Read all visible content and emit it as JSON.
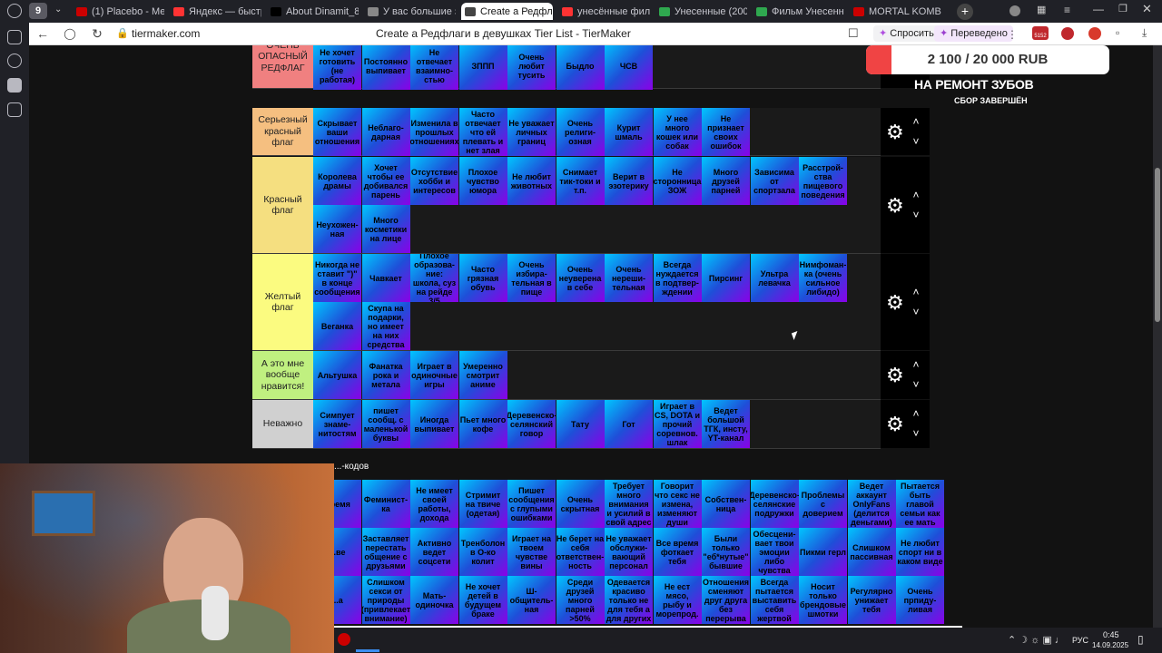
{
  "browser": {
    "tab_counter": "9",
    "tabs": [
      {
        "title": "(1) Placebo - Medi",
        "color": "#cc0000"
      },
      {
        "title": "Яндекс — быстрый",
        "color": "#ff3333"
      },
      {
        "title": "About Dinamit_8 - V",
        "color": "#000000"
      },
      {
        "title": "У вас большие зап",
        "color": "#888888"
      },
      {
        "title": "Create a Редфла",
        "color": "#444444"
      },
      {
        "title": "унесённые фильм",
        "color": "#ff3333"
      },
      {
        "title": "Унесенные (2002)",
        "color": "#2fa84f"
      },
      {
        "title": "Фильм Унесенные",
        "color": "#2fa84f"
      },
      {
        "title": "MORTAL KOMBAT",
        "color": "#cc0000"
      }
    ],
    "url": "tiermaker.com",
    "page_title": "Create a Редфлаги в девушках Tier List - TierMaker",
    "ask_label": "Спросить",
    "translated_label": "Переведено",
    "counter_badge": "5152"
  },
  "donation": {
    "amount": "2 100 / 20 000 RUB",
    "progress_fraction": 0.105,
    "goal": "НА РЕМОНТ ЗУБОВ",
    "status": "СБОР ЗАВЕРШЁН"
  },
  "tiers": [
    {
      "label": "ОЧЕНЬ ОПАСНЫЙ РЕДФЛАГ",
      "color": "#f08080",
      "cards": [
        "Не хочет готовить (не работая)",
        "Постоянно выпивает",
        "Не отвечает взаимно-стью",
        "ЗППП",
        "Очень любит тусить",
        "Быдло",
        "ЧСВ"
      ]
    },
    {
      "label": "Серьезный красный флаг",
      "color": "#f5bf80",
      "cards": [
        "Скрывает ваши отношения",
        "Неблаго-дарная",
        "Изменила в прошлых отношениях",
        "Часто отвечает что ей плевать и нет злая",
        "Не уважает личных границ",
        "Очень религи-озная",
        "Курит шмаль",
        "У нее много кошек или собак",
        "Не признает своих ошибок"
      ]
    },
    {
      "label": "Красный флаг",
      "color": "#f5df80",
      "cards": [
        "Королева драмы",
        "Хочет чтобы ее добивался парень",
        "Отсутствие хобби и интересов",
        "Плохое чувство юмора",
        "Не любит животных",
        "Снимает тик-токи и т.п.",
        "Верит в эзотерику",
        "Не сторонница ЗОЖ",
        "Много друзей парней",
        "Зависима от спортзала",
        "Расстрой-ства пищевого поведения",
        "Неухожен-ная",
        "Много косметики на лице"
      ]
    },
    {
      "label": "Желтый флаг",
      "color": "#fbfb80",
      "cards": [
        "Никогда не ставит \")\" в конце сообщения",
        "Чавкает",
        "Плохое образова-ние: школа, суз на рейде 3/5",
        "Часто грязная обувь",
        "Очень избира-тельная в пище",
        "Очень неуверена в себе",
        "Очень нереши-тельная",
        "Всегда нуждается в подтвер-ждении",
        "Пирсинг",
        "Ультра левачка",
        "Нимфоман-ка (очень сильное либидо)",
        "Веганка",
        "Скупа на подарки, но имеет на них средства"
      ]
    },
    {
      "label": "А это мне вообще нравится!",
      "color": "#c0f080",
      "cards": [
        "Альтушка",
        "Фанатка рока и метала",
        "Играет в одиночные игры",
        "Умеренно смотрит аниме"
      ]
    },
    {
      "label": "Неважно",
      "color": "#d0d0d0",
      "cards": [
        "Симпует знаме-нитостям",
        "пишет сообщ. с маленькой буквы",
        "Иногда выпивает",
        "Пьет много кофе",
        "Деревенско-селянский говор",
        "Тату",
        "Гот",
        "Играет в CS, DOTA и прочий соревнов. шлак",
        "Ведет большой ТГК, инсту, YT-канал"
      ]
    }
  ],
  "pool": {
    "label": "...-кодов",
    "cards": [
      "Время",
      "Феминист-ка",
      "Не имеет своей работы, дохода",
      "Стримит на твиче (одетая)",
      "Пишет сообщения с глупыми ошибками",
      "Очень скрытная",
      "Требует много внимания и усилий в свой адрес",
      "Говорит что секс не измена, изменяют души",
      "Собствен-ница",
      "Деревенско-селянские подружки",
      "Проблемы с доверием",
      "Ведет аккаунт OnlyFans (делится деньгами)",
      "Пытается быть главой семьи как ее мать",
      "...ве",
      "Заставляет перестать общение с друзьями",
      "Активно ведет соцсети",
      "Тренболон в О-ко колит",
      "Играет на твоем чувстве вины",
      "Не берет на себя ответствен-ность",
      "Не уважает обслужи-вающий персонал",
      "Все время фоткает тебя",
      "Были только \"еб*нутые\" бывшие",
      "Обесцени-вает твои эмоции либо чувства",
      "Пикми герл",
      "Слишком пассивная",
      "Не любит спорт ни в каком виде",
      "...а",
      "Слишком секси от природы (привлекает внимание)",
      "Мать-одиночка",
      "Не хочет детей в будущем браке",
      "Ш-общитель-ная",
      "Среди друзей много парней >50%",
      "Одевается красиво только не для тебя а для других",
      "Не ест мясо, рыбу и морепрод.",
      "Отношения сменяют друг друга без перерыва",
      "Всегда пытается выставить себя жертвой",
      "Носит только брендовые шмотки",
      "Регулярно унижает тебя",
      "Очень прпиду-ливая"
    ]
  },
  "taskbar": {
    "lang": "РУС",
    "time": "0:45",
    "date": "14.09.2025"
  }
}
